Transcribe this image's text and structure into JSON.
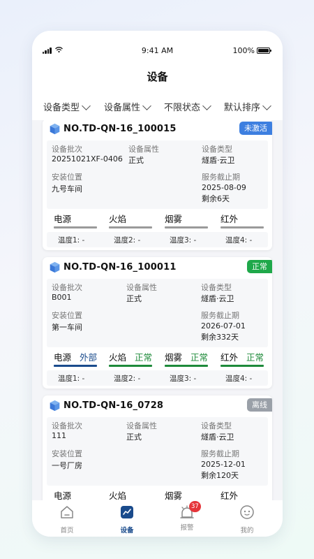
{
  "status_bar": {
    "time": "9:41 AM",
    "battery": "100%"
  },
  "header": {
    "title": "设备"
  },
  "filters": [
    "设备类型",
    "设备属性",
    "不限状态",
    "默认排序"
  ],
  "field_labels": {
    "batch": "设备批次",
    "attribute": "设备属性",
    "type": "设备类型",
    "location": "安装位置",
    "service_end": "服务截止期"
  },
  "devices": [
    {
      "id": "NO.TD-QN-16_100015",
      "status": "未激活",
      "batch": "20251021XF-0406",
      "attribute": "正式",
      "type": "燧盾·云卫",
      "location": "九号车间",
      "service_end": "2025-08-09",
      "remaining": "剩余6天",
      "sensors": [
        {
          "name": "电源",
          "status": "",
          "color": "#9a9a9a"
        },
        {
          "name": "火焰",
          "status": "",
          "color": "#9a9a9a"
        },
        {
          "name": "烟雾",
          "status": "",
          "color": "#9a9a9a"
        },
        {
          "name": "红外",
          "status": "",
          "color": "#9a9a9a"
        }
      ],
      "temps": [
        "温度1:  -",
        "温度2:  -",
        "温度3:  -",
        "温度4:  -"
      ]
    },
    {
      "id": "NO.TD-QN-16_100011",
      "status": "正常",
      "batch": "B001",
      "attribute": "正式",
      "type": "燧盾·云卫",
      "location": "第一车间",
      "service_end": "2026-07-01",
      "remaining": "剩余332天",
      "sensors": [
        {
          "name": "电源",
          "status": "外部",
          "color": "#1a4b8c"
        },
        {
          "name": "火焰",
          "status": "正常",
          "color": "#1e8a3a"
        },
        {
          "name": "烟雾",
          "status": "正常",
          "color": "#1e8a3a"
        },
        {
          "name": "红外",
          "status": "正常",
          "color": "#1e8a3a"
        }
      ],
      "temps": [
        "温度1:  -",
        "温度2:  -",
        "温度3:  -",
        "温度4:  -"
      ]
    },
    {
      "id": "NO.TD-QN-16_0728",
      "status": "离线",
      "batch": "111",
      "attribute": "正式",
      "type": "燧盾·云卫",
      "location": "一号厂房",
      "service_end": "2025-12-01",
      "remaining": "剩余120天",
      "sensors": [
        {
          "name": "电源",
          "status": "",
          "color": "#9a9a9a"
        },
        {
          "name": "火焰",
          "status": "",
          "color": "#9a9a9a"
        },
        {
          "name": "烟雾",
          "status": "",
          "color": "#9a9a9a"
        },
        {
          "name": "红外",
          "status": "",
          "color": "#9a9a9a"
        }
      ],
      "temps": []
    }
  ],
  "tabbar": {
    "items": [
      {
        "label": "首页",
        "icon": "home-icon"
      },
      {
        "label": "设备",
        "icon": "device-chart-icon"
      },
      {
        "label": "报警",
        "icon": "alarm-bell-icon",
        "count": "37"
      },
      {
        "label": "我的",
        "icon": "profile-face-icon"
      }
    ],
    "active": "设备"
  }
}
